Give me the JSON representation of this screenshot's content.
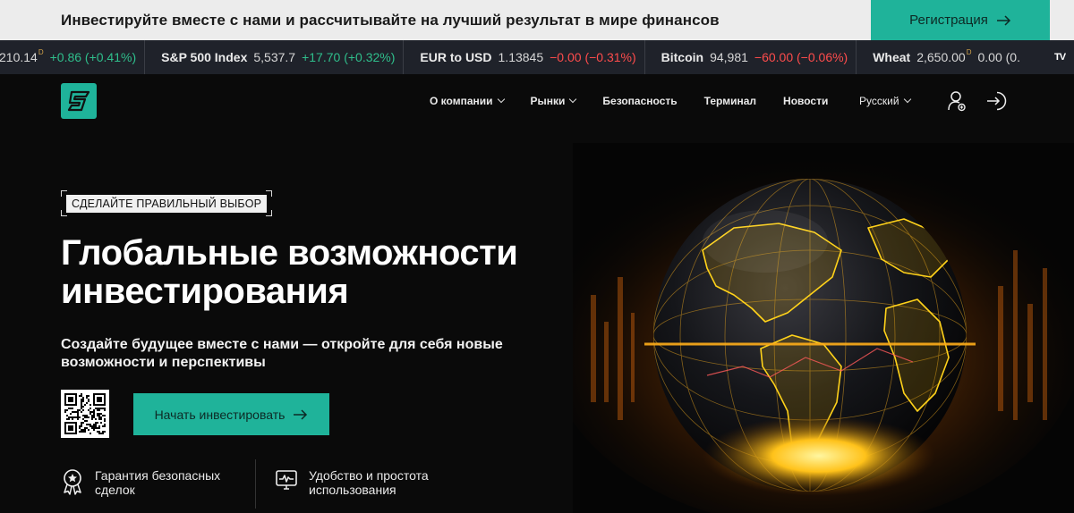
{
  "banner": {
    "text": "Инвестируйте вместе с нами и рассчитывайте на лучший результат в мире финансов",
    "register_label": "Регистрация"
  },
  "ticker": [
    {
      "symbol": "",
      "price": "210.14",
      "delayed": "D",
      "change": "+0.86 (+0.41%)",
      "dir": "up"
    },
    {
      "symbol": "S&P 500 Index",
      "price": "5,537.7",
      "delayed": "",
      "change": "+17.70 (+0.32%)",
      "dir": "up"
    },
    {
      "symbol": "EUR to USD",
      "price": "1.13845",
      "delayed": "",
      "change": "−0.00 (−0.31%)",
      "dir": "down"
    },
    {
      "symbol": "Bitcoin",
      "price": "94,981",
      "delayed": "",
      "change": "−60.00 (−0.06%)",
      "dir": "down"
    },
    {
      "symbol": "Wheat",
      "price": "2,650.00",
      "delayed": "D",
      "change": "0.00 (0.",
      "dir": "flat"
    }
  ],
  "ticker_brand": "TV",
  "nav": {
    "items": [
      {
        "label": "О компании",
        "dropdown": true
      },
      {
        "label": "Рынки",
        "dropdown": true
      },
      {
        "label": "Безопасность",
        "dropdown": false
      },
      {
        "label": "Терминал",
        "dropdown": false
      },
      {
        "label": "Новости",
        "dropdown": false
      }
    ],
    "language": "Русский"
  },
  "hero": {
    "eyebrow": "СДЕЛАЙТЕ ПРАВИЛЬНЫЙ ВЫБОР",
    "title_line1": "Глобальные возможности",
    "title_line2": "инвестирования",
    "subtitle": "Создайте будущее вместе с нами — откройте для себя новые возможности и перспективы",
    "cta_label": "Начать инвестировать"
  },
  "features": [
    {
      "icon": "award-badge-icon",
      "text_line1": "Гарантия безопасных",
      "text_line2": "сделок"
    },
    {
      "icon": "monitor-chart-icon",
      "text_line1": "Удобство и простота",
      "text_line2": "использования"
    }
  ],
  "colors": {
    "accent": "#1fb39a",
    "background": "#0a0a0a",
    "banner_bg": "#ececec",
    "ticker_bg": "#1f222a",
    "up": "#2fbf8c",
    "down": "#ff4c4c"
  }
}
